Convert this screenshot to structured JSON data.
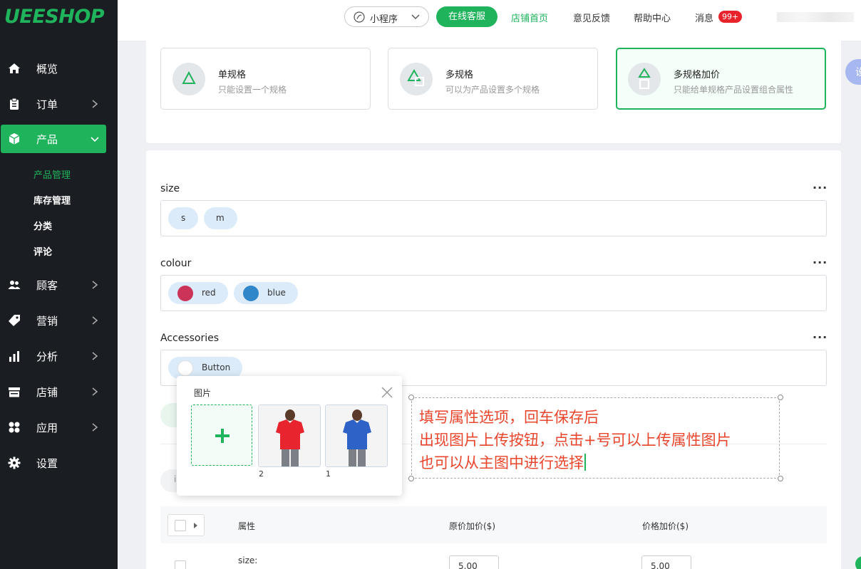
{
  "brand": {
    "logo_text": "UEESHOP"
  },
  "sidebar": {
    "items": [
      {
        "label": "概览",
        "icon": "home-icon"
      },
      {
        "label": "订单",
        "icon": "clipboard-icon"
      },
      {
        "label": "产品",
        "icon": "cube-icon"
      },
      {
        "label": "顾客",
        "icon": "users-icon"
      },
      {
        "label": "营销",
        "icon": "tag-icon"
      },
      {
        "label": "分析",
        "icon": "bar-chart-icon"
      },
      {
        "label": "店铺",
        "icon": "store-icon"
      },
      {
        "label": "应用",
        "icon": "grid-icon"
      },
      {
        "label": "设置",
        "icon": "gear-icon"
      }
    ],
    "product_sub": [
      "产品管理",
      "库存管理",
      "分类",
      "评论"
    ]
  },
  "header": {
    "mini_program": "小程序",
    "online_service": "在线客服",
    "store_home": "店铺首页",
    "feedback": "意见反馈",
    "help": "帮助中心",
    "messages": "消息",
    "badge": "99+"
  },
  "spec_types": [
    {
      "title": "单规格",
      "desc": "只能设置一个规格"
    },
    {
      "title": "多规格",
      "desc": "可以为产品设置多个规格"
    },
    {
      "title": "多规格加价",
      "desc": "只能给单规格产品设置组合属性"
    }
  ],
  "attributes": {
    "more": "···",
    "size": {
      "title": "size",
      "options": [
        "s",
        "m"
      ]
    },
    "colour": {
      "title": "colour",
      "options": [
        {
          "label": "red",
          "color": "#cc3358"
        },
        {
          "label": "blue",
          "color": "#2f86c9"
        }
      ]
    },
    "accessories": {
      "title": "Accessories",
      "options": [
        "Button"
      ]
    }
  },
  "popup": {
    "title": "图片",
    "images": [
      {
        "num": "2",
        "shirt_color": "#e8242f"
      },
      {
        "num": "1",
        "shirt_color": "#2e62c7"
      }
    ]
  },
  "annotation": {
    "lines": [
      "填写属性选项，回车保存后",
      "出现图片上传按钮，点击+号可以上传属性图片",
      "也可以从主图中进行选择"
    ]
  },
  "table": {
    "col_attr": "属性",
    "col_orig": "原价加价($)",
    "col_price": "价格加价($)",
    "row_label": "size:",
    "orig_value": "5.00",
    "price_value": "5.00",
    "faint_label": "i"
  },
  "side_float": "设"
}
